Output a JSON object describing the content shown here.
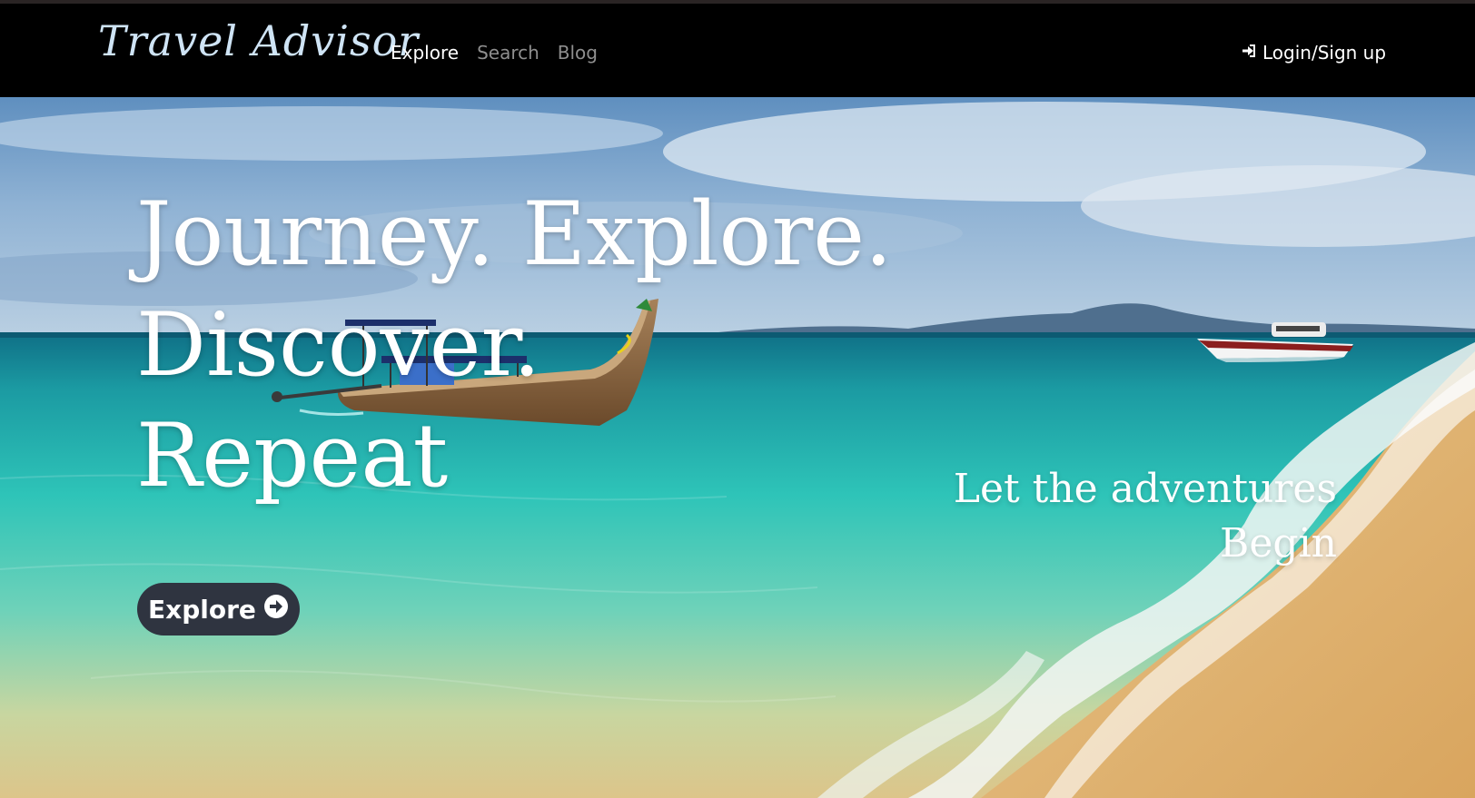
{
  "brand": {
    "name": "Travel Advisor"
  },
  "nav": {
    "items": [
      {
        "label": "Explore",
        "active": true
      },
      {
        "label": "Search",
        "active": false
      },
      {
        "label": "Blog",
        "active": false
      }
    ],
    "login_label": "Login/Sign up",
    "login_icon": "sign-in-icon"
  },
  "hero": {
    "headline_line1": "Journey. Explore. Discover.",
    "headline_line2": "Repeat",
    "tagline_line1": "Let the adventures",
    "tagline_line2": "Begin",
    "cta_label": "Explore",
    "cta_icon": "arrow-circle-right-icon"
  },
  "colors": {
    "navbar": "#000000",
    "brand": "#cfe4f5",
    "nav_active": "#ffffff",
    "nav_inactive": "#8e8e8e",
    "cta_bg": "#2f3440"
  }
}
